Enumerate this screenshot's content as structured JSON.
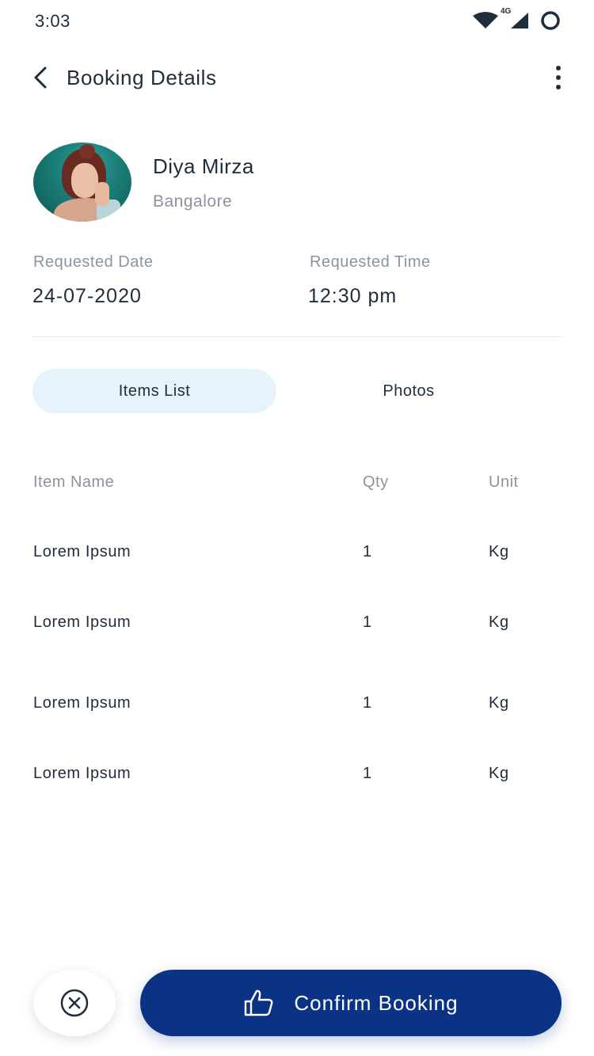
{
  "status_bar": {
    "time": "3:03",
    "network_label": "4G",
    "icons": [
      "wifi-icon",
      "cellular-signal-icon",
      "battery-ring-icon"
    ]
  },
  "header": {
    "title": "Booking Details",
    "back_icon": "chevron-left-icon",
    "menu_icon": "more-vertical-icon"
  },
  "profile": {
    "name": "Diya Mirza",
    "city": "Bangalore"
  },
  "request": {
    "date_label": "Requested Date",
    "date_value": "24-07-2020",
    "time_label": "Requested Time",
    "time_value": "12:30 pm"
  },
  "tabs": [
    {
      "label": "Items List",
      "active": true
    },
    {
      "label": "Photos",
      "active": false
    }
  ],
  "table": {
    "headers": [
      "Item Name",
      "Qty",
      "Unit"
    ],
    "rows": [
      {
        "name": "Lorem Ipsum",
        "qty": "1",
        "unit": "Kg"
      },
      {
        "name": "Lorem Ipsum",
        "qty": "1",
        "unit": "Kg"
      },
      {
        "name": "Lorem Ipsum",
        "qty": "1",
        "unit": "Kg"
      },
      {
        "name": "Lorem Ipsum",
        "qty": "1",
        "unit": "Kg"
      }
    ]
  },
  "actions": {
    "cancel_icon": "close-circle-icon",
    "confirm_icon": "thumbs-up-icon",
    "confirm_label": "Confirm Booking"
  },
  "colors": {
    "primary": "#0a3386",
    "tab_active_bg": "#e6f3fb",
    "text_dark": "#1f2d3d",
    "text_muted": "#8a94a0"
  }
}
